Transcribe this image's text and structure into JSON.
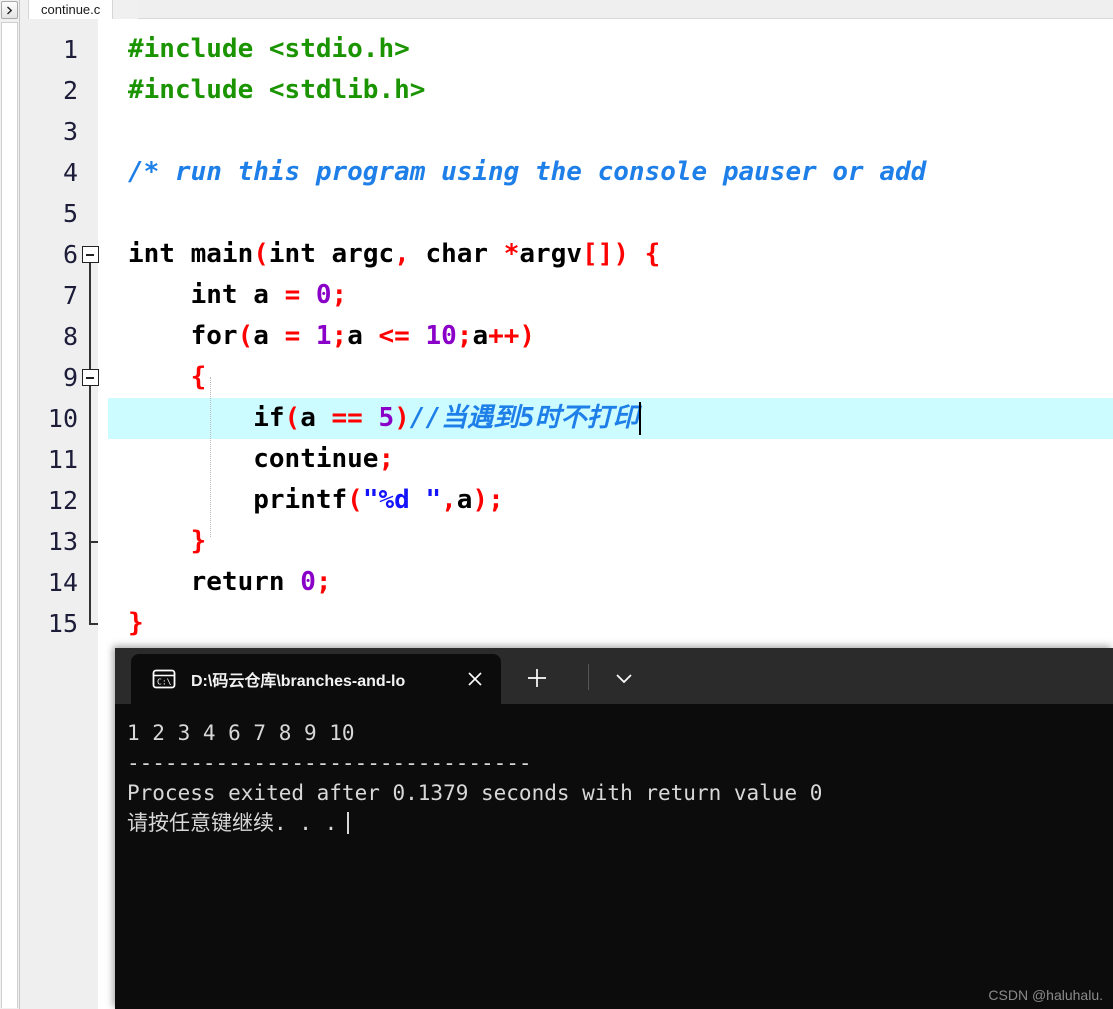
{
  "ide": {
    "tab": {
      "label": "continue.c"
    },
    "scroll_button_icon": "chevron-right-icon"
  },
  "editor": {
    "highlighted_line": 10,
    "lines": [
      {
        "no": "1",
        "tokens": [
          {
            "t": "#include ",
            "c": "t-pre"
          },
          {
            "t": "<stdio.h>",
            "c": "t-pre"
          }
        ]
      },
      {
        "no": "2",
        "tokens": [
          {
            "t": "#include ",
            "c": "t-pre"
          },
          {
            "t": "<stdlib.h>",
            "c": "t-pre"
          }
        ]
      },
      {
        "no": "3",
        "tokens": []
      },
      {
        "no": "4",
        "tokens": [
          {
            "t": "/* run this program using the console pauser or add",
            "c": "t-cmt"
          }
        ]
      },
      {
        "no": "5",
        "tokens": []
      },
      {
        "no": "6",
        "tokens": [
          {
            "t": "int",
            "c": "t-kw"
          },
          {
            "t": " main",
            "c": "t-id"
          },
          {
            "t": "(",
            "c": "t-punc"
          },
          {
            "t": "int",
            "c": "t-kw"
          },
          {
            "t": " argc",
            "c": "t-id"
          },
          {
            "t": ",",
            "c": "t-punc"
          },
          {
            "t": " ",
            "c": "t-id"
          },
          {
            "t": "char",
            "c": "t-kw"
          },
          {
            "t": " ",
            "c": "t-id"
          },
          {
            "t": "*",
            "c": "t-punc"
          },
          {
            "t": "argv",
            "c": "t-id"
          },
          {
            "t": "[]",
            "c": "t-punc"
          },
          {
            "t": ")",
            "c": "t-punc"
          },
          {
            "t": " ",
            "c": "t-id"
          },
          {
            "t": "{",
            "c": "t-punc"
          }
        ]
      },
      {
        "no": "7",
        "tokens": [
          {
            "t": "    ",
            "c": "t-id"
          },
          {
            "t": "int",
            "c": "t-kw"
          },
          {
            "t": " a ",
            "c": "t-id"
          },
          {
            "t": "=",
            "c": "t-punc"
          },
          {
            "t": " ",
            "c": "t-id"
          },
          {
            "t": "0",
            "c": "t-num"
          },
          {
            "t": ";",
            "c": "t-punc"
          }
        ]
      },
      {
        "no": "8",
        "tokens": [
          {
            "t": "    ",
            "c": "t-id"
          },
          {
            "t": "for",
            "c": "t-kw"
          },
          {
            "t": "(",
            "c": "t-punc"
          },
          {
            "t": "a ",
            "c": "t-id"
          },
          {
            "t": "=",
            "c": "t-punc"
          },
          {
            "t": " ",
            "c": "t-id"
          },
          {
            "t": "1",
            "c": "t-num"
          },
          {
            "t": ";",
            "c": "t-punc"
          },
          {
            "t": "a ",
            "c": "t-id"
          },
          {
            "t": "<=",
            "c": "t-punc"
          },
          {
            "t": " ",
            "c": "t-id"
          },
          {
            "t": "10",
            "c": "t-num"
          },
          {
            "t": ";",
            "c": "t-punc"
          },
          {
            "t": "a",
            "c": "t-id"
          },
          {
            "t": "++",
            "c": "t-punc"
          },
          {
            "t": ")",
            "c": "t-punc"
          }
        ]
      },
      {
        "no": "9",
        "tokens": [
          {
            "t": "    ",
            "c": "t-id"
          },
          {
            "t": "{",
            "c": "t-punc"
          }
        ]
      },
      {
        "no": "10",
        "tokens": [
          {
            "t": "        ",
            "c": "t-id"
          },
          {
            "t": "if",
            "c": "t-kw"
          },
          {
            "t": "(",
            "c": "t-punc"
          },
          {
            "t": "a ",
            "c": "t-id"
          },
          {
            "t": "==",
            "c": "t-punc"
          },
          {
            "t": " ",
            "c": "t-id"
          },
          {
            "t": "5",
            "c": "t-num"
          },
          {
            "t": ")",
            "c": "t-punc"
          },
          {
            "t": "//当遇到5时不打印",
            "c": "t-cmt"
          }
        ]
      },
      {
        "no": "11",
        "tokens": [
          {
            "t": "        ",
            "c": "t-id"
          },
          {
            "t": "continue",
            "c": "t-kw"
          },
          {
            "t": ";",
            "c": "t-punc"
          }
        ]
      },
      {
        "no": "12",
        "tokens": [
          {
            "t": "        ",
            "c": "t-id"
          },
          {
            "t": "printf",
            "c": "t-id"
          },
          {
            "t": "(",
            "c": "t-punc"
          },
          {
            "t": "\"",
            "c": "t-str"
          },
          {
            "t": "%d ",
            "c": "t-str"
          },
          {
            "t": "\"",
            "c": "t-str"
          },
          {
            "t": ",",
            "c": "t-punc"
          },
          {
            "t": "a",
            "c": "t-id"
          },
          {
            "t": ")",
            "c": "t-punc"
          },
          {
            "t": ";",
            "c": "t-punc"
          }
        ]
      },
      {
        "no": "13",
        "tokens": [
          {
            "t": "    ",
            "c": "t-id"
          },
          {
            "t": "}",
            "c": "t-punc"
          }
        ]
      },
      {
        "no": "14",
        "tokens": [
          {
            "t": "    ",
            "c": "t-id"
          },
          {
            "t": "return",
            "c": "t-kw"
          },
          {
            "t": " ",
            "c": "t-id"
          },
          {
            "t": "0",
            "c": "t-num"
          },
          {
            "t": ";",
            "c": "t-punc"
          }
        ]
      },
      {
        "no": "15",
        "tokens": [
          {
            "t": "}",
            "c": "t-punc"
          }
        ]
      }
    ],
    "fold_markers": [
      {
        "line": 6,
        "type": "box-collapse"
      },
      {
        "line": 9,
        "type": "box-collapse"
      },
      {
        "line": 13,
        "type": "tick"
      },
      {
        "line": 15,
        "type": "end"
      }
    ]
  },
  "terminal": {
    "tab": {
      "title": "D:\\码云仓库\\branches-and-lo",
      "icon": "cmd-prompt-icon",
      "close_icon": "close-icon"
    },
    "new_tab_icon": "plus-icon",
    "dropdown_icon": "chevron-down-icon",
    "output": [
      "1 2 3 4 6 7 8 9 10",
      "--------------------------------",
      "Process exited after 0.1379 seconds with return value 0",
      "请按任意键继续. . ."
    ],
    "watermark": "CSDN @haluhalu."
  },
  "colors": {
    "highlight_line": "#ccfcff",
    "preprocessor": "#1a9400",
    "comment": "#1e7fe8",
    "punctuation": "#ff0000",
    "number": "#8a00c8",
    "string": "#1414ff",
    "terminal_bg": "#0c0c0c",
    "terminal_titlebar": "#2b2b2b",
    "gutter_bg": "#efefef"
  }
}
